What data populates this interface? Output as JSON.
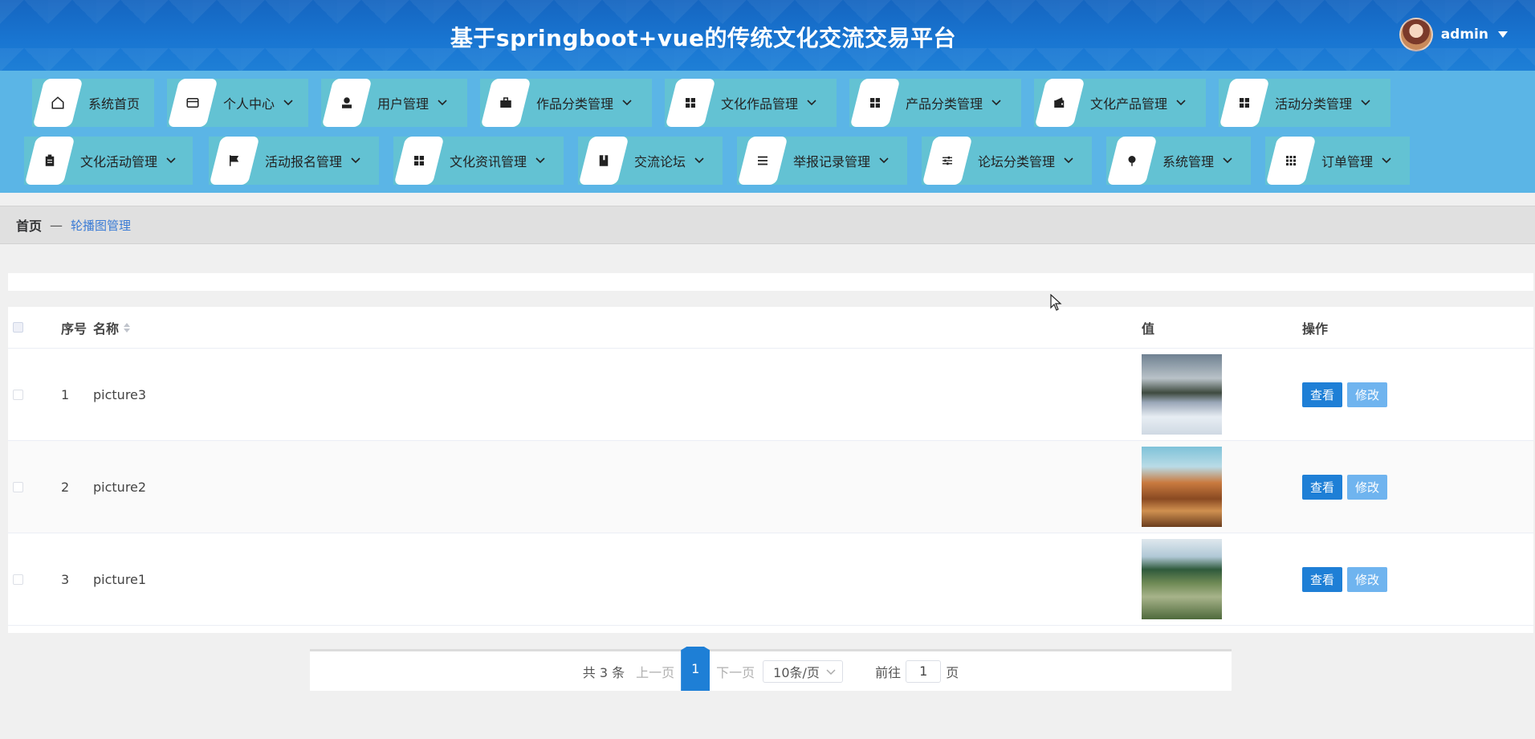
{
  "header": {
    "title": "基于springboot+vue的传统文化交流交易平台",
    "username": "admin"
  },
  "nav": {
    "row1": [
      {
        "label": "系统首页",
        "icon": "home-icon",
        "chevron": false
      },
      {
        "label": "个人中心",
        "icon": "card-icon",
        "chevron": true
      },
      {
        "label": "用户管理",
        "icon": "person-icon",
        "chevron": true
      },
      {
        "label": "作品分类管理",
        "icon": "briefcase-icon",
        "chevron": true
      },
      {
        "label": "文化作品管理",
        "icon": "grid-icon",
        "chevron": true
      },
      {
        "label": "产品分类管理",
        "icon": "grid-icon",
        "chevron": true
      },
      {
        "label": "文化产品管理",
        "icon": "wallet-icon",
        "chevron": true
      },
      {
        "label": "活动分类管理",
        "icon": "grid-icon",
        "chevron": true
      }
    ],
    "row2": [
      {
        "label": "文化活动管理",
        "icon": "clipboard-icon",
        "chevron": true
      },
      {
        "label": "活动报名管理",
        "icon": "flag-icon",
        "chevron": true
      },
      {
        "label": "文化资讯管理",
        "icon": "grid-icon",
        "chevron": true
      },
      {
        "label": "交流论坛",
        "icon": "book-icon",
        "chevron": true
      },
      {
        "label": "举报记录管理",
        "icon": "list-icon",
        "chevron": true
      },
      {
        "label": "论坛分类管理",
        "icon": "sliders-icon",
        "chevron": true
      },
      {
        "label": "系统管理",
        "icon": "pin-icon",
        "chevron": true
      },
      {
        "label": "订单管理",
        "icon": "apps-icon",
        "chevron": true
      }
    ]
  },
  "breadcrumb": {
    "home": "首页",
    "separator": "—",
    "current": "轮播图管理"
  },
  "table": {
    "headers": {
      "index": "序号",
      "name": "名称",
      "value": "值",
      "actions": "操作"
    },
    "rows": [
      {
        "index": "1",
        "name": "picture3"
      },
      {
        "index": "2",
        "name": "picture2"
      },
      {
        "index": "3",
        "name": "picture1"
      }
    ],
    "view_label": "查看",
    "edit_label": "修改"
  },
  "pagination": {
    "total": "共 3 条",
    "prev": "上一页",
    "current_page": "1",
    "next": "下一页",
    "page_size": "10条/页",
    "goto_label": "前往",
    "goto_value": "1",
    "page_unit": "页"
  },
  "colors": {
    "header_bg": "#1976d2",
    "nav_bg": "#5bb5e6",
    "nav_item": "#63c2d3",
    "primary": "#1e7fd6",
    "edit": "#6fb4ef"
  }
}
